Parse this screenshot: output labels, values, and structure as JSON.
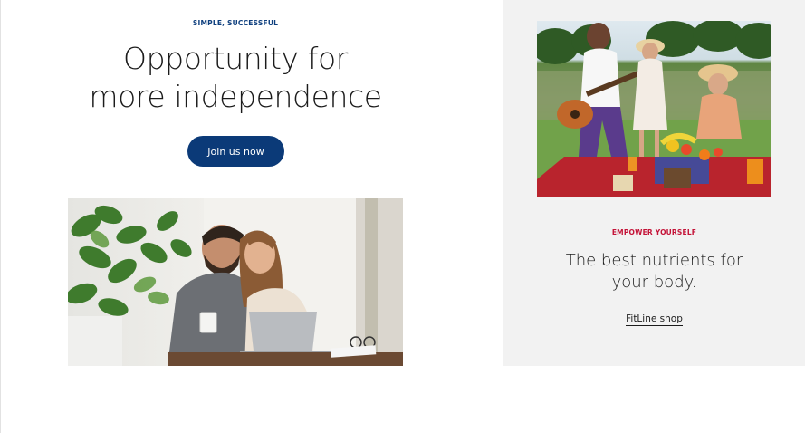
{
  "promo_left": {
    "eyebrow": "SIMPLE, SUCCESSFUL",
    "headline_line1": "Opportunity for",
    "headline_line2": "more independence",
    "cta_label": "Join us now",
    "image_alt": "couple laughing at laptop"
  },
  "promo_right": {
    "eyebrow": "EMPOWER YOURSELF",
    "headline_line1": "The best nutrients for",
    "headline_line2": "your body.",
    "link_label": "FitLine shop",
    "image_alt": "family picnic with guitar"
  },
  "colors": {
    "primary_blue": "#0b3a78",
    "accent_red": "#c41338",
    "card_grey": "#f2f2f2"
  }
}
